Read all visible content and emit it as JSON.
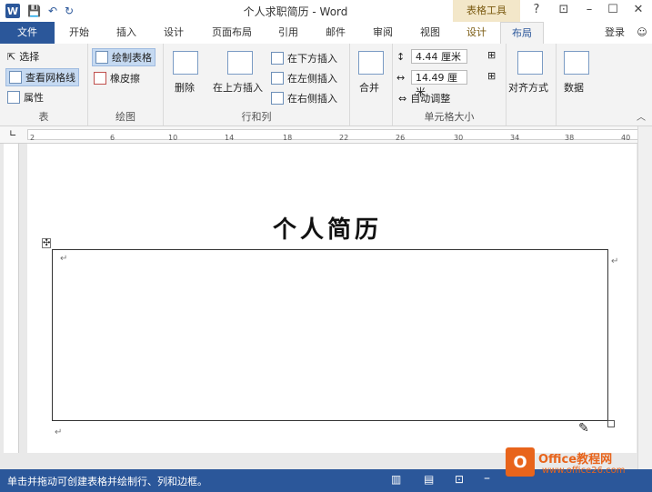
{
  "titlebar": {
    "app_icon": "W",
    "title": "个人求职简历 - Word",
    "context_tab": "表格工具",
    "help": "?",
    "restore_ribbon": "⊡",
    "minimize": "–",
    "maximize": "☐",
    "close": "✕"
  },
  "quick_access": {
    "save_icon": "save-icon",
    "undo_icon": "undo-icon",
    "redo_icon": "redo-icon"
  },
  "tabs": [
    "文件",
    "开始",
    "插入",
    "设计",
    "页面布局",
    "引用",
    "邮件",
    "审阅",
    "视图",
    "设计",
    "布局"
  ],
  "login": "登录",
  "ribbon": {
    "table_group": {
      "label": "表",
      "select": "选择",
      "gridlines": "查看网格线",
      "properties": "属性"
    },
    "draw_group": {
      "label": "绘图",
      "draw_table": "绘制表格",
      "eraser": "橡皮擦"
    },
    "rows_group": {
      "label": "行和列",
      "delete": "删除",
      "insert_above": "在上方插入",
      "insert_below": "在下方插入",
      "insert_left": "在左侧插入",
      "insert_right": "在右侧插入"
    },
    "merge_group": {
      "label": "合并",
      "merge": "合并"
    },
    "cell_size_group": {
      "label": "单元格大小",
      "height": "4.44 厘米",
      "width": "14.49 厘米",
      "autofit": "自动调整"
    },
    "align_group": {
      "label": "对齐方式"
    },
    "data_group": {
      "label": "数据"
    }
  },
  "ruler": {
    "ticks": [
      "2",
      "2",
      "4",
      "6",
      "8",
      "10",
      "12",
      "14",
      "16",
      "18",
      "20",
      "22",
      "24",
      "26",
      "28",
      "30",
      "32",
      "34",
      "36",
      "38",
      "40"
    ]
  },
  "document": {
    "heading": "个人简历",
    "paragraph_mark": "↵"
  },
  "status": {
    "message": "单击并拖动可创建表格并绘制行、列和边框。"
  },
  "watermark": {
    "brand": "Office教程网",
    "url": "www.office26.com"
  },
  "colors": {
    "accent": "#2b579a",
    "context_tab_bg": "#f3e7c9",
    "watermark": "#e8641b"
  }
}
